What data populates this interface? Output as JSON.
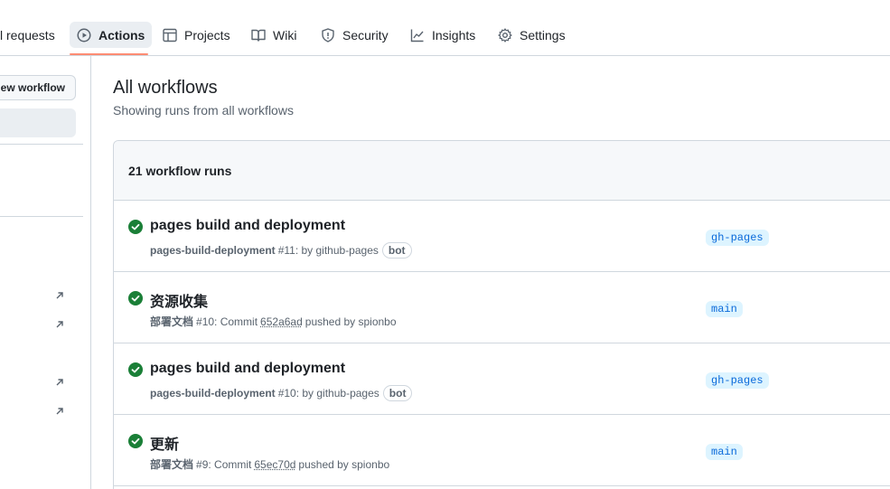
{
  "tabs": [
    {
      "label": "l requests",
      "icon": "pull-request-icon"
    },
    {
      "label": "Actions",
      "icon": "play-icon",
      "active": true
    },
    {
      "label": "Projects",
      "icon": "table-icon"
    },
    {
      "label": "Wiki",
      "icon": "book-icon"
    },
    {
      "label": "Security",
      "icon": "shield-icon"
    },
    {
      "label": "Insights",
      "icon": "graph-icon"
    },
    {
      "label": "Settings",
      "icon": "gear-icon"
    }
  ],
  "sidebar": {
    "new_workflow_label": "New workflow",
    "external_links": [
      "link-1",
      "link-2",
      "link-3",
      "link-4"
    ]
  },
  "main": {
    "title": "All workflows",
    "subtitle": "Showing runs from all workflows",
    "runs_count_label": "21 workflow runs"
  },
  "runs": [
    {
      "title": "pages build and deployment",
      "workflow": "pages-build-deployment",
      "detail": "#11: by github-pages",
      "commit": "",
      "suffix": "",
      "bot": "bot",
      "branch": "gh-pages",
      "status": "success"
    },
    {
      "title": "资源收集",
      "workflow": "部署文档",
      "detail": "#10: Commit",
      "commit": "652a6ad",
      "suffix": "pushed by spionbo",
      "bot": "",
      "branch": "main",
      "status": "success"
    },
    {
      "title": "pages build and deployment",
      "workflow": "pages-build-deployment",
      "detail": "#10: by github-pages",
      "commit": "",
      "suffix": "",
      "bot": "bot",
      "branch": "gh-pages",
      "status": "success"
    },
    {
      "title": "更新",
      "workflow": "部署文档",
      "detail": "#9: Commit",
      "commit": "65ec70d",
      "suffix": "pushed by spionbo",
      "bot": "",
      "branch": "main",
      "status": "success"
    }
  ],
  "colors": {
    "success": "#1a7f37",
    "accent": "#fd8c73",
    "branch_bg": "#ddf4ff",
    "branch_fg": "#0969da"
  }
}
